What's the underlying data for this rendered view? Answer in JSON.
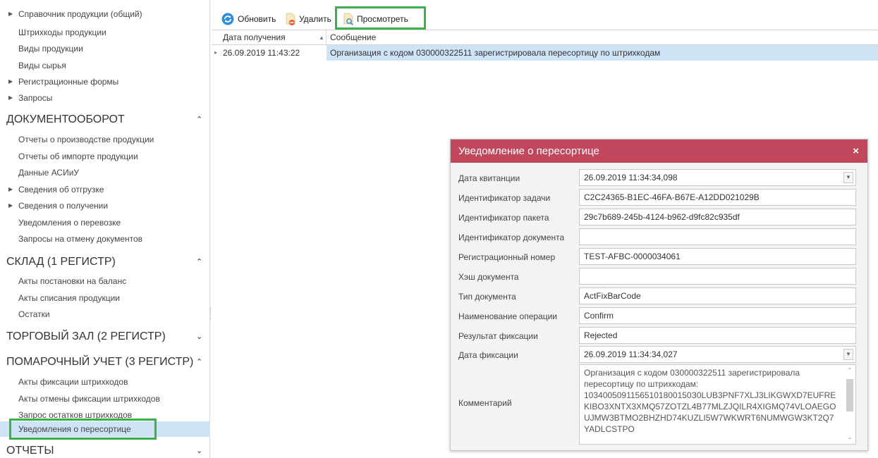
{
  "sidebar": {
    "top_items": [
      {
        "label": "Справочник продукции (общий)",
        "tree": true
      },
      {
        "label": "Штрихкоды продукции",
        "tree": false
      },
      {
        "label": "Виды продукции",
        "tree": false
      },
      {
        "label": "Виды сырья",
        "tree": false
      },
      {
        "label": "Регистрационные формы",
        "tree": true
      },
      {
        "label": "Запросы",
        "tree": true
      }
    ],
    "sections": [
      {
        "title": "ДОКУМЕНТООБОРОТ",
        "items": [
          {
            "label": "Отчеты о производстве продукции"
          },
          {
            "label": "Отчеты об импорте продукции"
          },
          {
            "label": "Данные АСИиУ"
          },
          {
            "label": "Сведения об отгрузке"
          },
          {
            "label": "Сведения о получении"
          },
          {
            "label": "Уведомления о перевозке"
          },
          {
            "label": "Запросы на отмену документов"
          }
        ]
      },
      {
        "title": "СКЛАД (1 РЕГИСТР)",
        "items": [
          {
            "label": "Акты постановки на баланс"
          },
          {
            "label": "Акты списания продукции"
          },
          {
            "label": "Остатки"
          }
        ]
      },
      {
        "title": "ТОРГОВЫЙ ЗАЛ (2 РЕГИСТР)",
        "items": []
      },
      {
        "title": "ПОМАРОЧНЫЙ УЧЕТ (3 РЕГИСТР)",
        "items": [
          {
            "label": "Акты фиксации штрихкодов"
          },
          {
            "label": "Акты отмены фиксации штрихкодов"
          },
          {
            "label": "Запрос остатков штрихкодов"
          },
          {
            "label": "Уведомления о пересортице"
          }
        ]
      },
      {
        "title": "ОТЧЕТЫ",
        "items": []
      }
    ]
  },
  "toolbar": {
    "refresh_label": "Обновить",
    "delete_label": "Удалить",
    "view_label": "Просмотреть"
  },
  "grid": {
    "columns": [
      "Дата получения",
      "Сообщение"
    ],
    "rows": [
      {
        "date": "26.09.2019 11:43:22",
        "message": "Организация с кодом 030000322511 зарегистрировала пересортицу по штрихкодам"
      }
    ]
  },
  "dialog": {
    "title": "Уведомление о пересортице",
    "close_glyph": "×",
    "fields": {
      "receipt_date": {
        "label": "Дата квитанции",
        "value": "26.09.2019 11:34:34,098"
      },
      "task_id": {
        "label": "Идентификатор задачи",
        "value": "C2C24365-B1EC-46FA-B67E-A12DD021029B"
      },
      "package_id": {
        "label": "Идентификатор пакета",
        "value": "29c7b689-245b-4124-b962-d9fc82c935df"
      },
      "document_id": {
        "label": "Идентификатор документа",
        "value": ""
      },
      "reg_number": {
        "label": "Регистрационный номер",
        "value": "TEST-AFBC-0000034061"
      },
      "doc_hash": {
        "label": "Хэш документа",
        "value": ""
      },
      "doc_type": {
        "label": "Тип документа",
        "value": "ActFixBarCode"
      },
      "operation_name": {
        "label": "Наименование операции",
        "value": "Confirm"
      },
      "fix_result": {
        "label": "Результат фиксации",
        "value": "Rejected"
      },
      "fix_date": {
        "label": "Дата фиксации",
        "value": "26.09.2019 11:34:34,027"
      },
      "comment": {
        "label": "Комментарий",
        "line1": "Организация с кодом 030000322511 зарегистрировала",
        "line2": "пересортицу по штрихкодам:",
        "line3": "10340050911565101800150З0LUB3PNF7XLJ3LIKGWXD7EUFRE",
        "line4": "KIBO3XNTX3XMQ57ZOTZL4B77MLZJQILR4XIGMQ74VLOAEGO",
        "line5": "UJMW3BTMO2BHZHD74KUZLI5W7WKWRT6NUMWGW3KT2Q7",
        "line6": "YADLCSTPO"
      }
    }
  }
}
